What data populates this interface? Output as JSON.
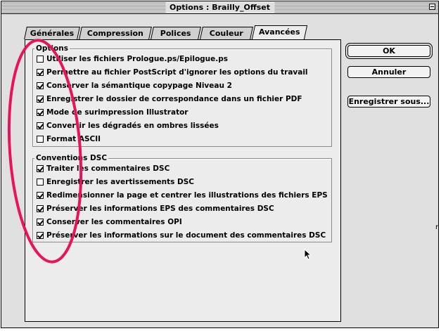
{
  "window": {
    "title": "Options : Brailly_Offset"
  },
  "tabs": [
    {
      "label": "Générales",
      "active": false
    },
    {
      "label": "Compression",
      "active": false
    },
    {
      "label": "Polices",
      "active": false
    },
    {
      "label": "Couleur",
      "active": false
    },
    {
      "label": "Avancées",
      "active": true
    }
  ],
  "options_group": {
    "title": "Options",
    "items": [
      {
        "label": "Utiliser les fichiers Prologue.ps/Epilogue.ps",
        "checked": false
      },
      {
        "label": "Permettre au fichier PostScript d'ignorer les options du travail",
        "checked": true
      },
      {
        "label": "Conserver la sémantique copypage Niveau 2",
        "checked": true
      },
      {
        "label": "Enregistrer le dossier de correspondance dans un fichier PDF",
        "checked": true
      },
      {
        "label": "Mode de surimpression Illustrator",
        "checked": true
      },
      {
        "label": "Convertir les dégradés en ombres lissées",
        "checked": true
      },
      {
        "label": "Format ASCII",
        "checked": false
      }
    ]
  },
  "dsc_group": {
    "title": "Conventions DSC",
    "items": [
      {
        "label": "Traiter les commentaires DSC",
        "checked": true
      },
      {
        "label": "Enregistrer les avertissements DSC",
        "checked": false
      },
      {
        "label": "Redimensionner la page et centrer les illustrations des fichiers EPS",
        "checked": true
      },
      {
        "label": "Préserver les informations EPS des commentaires DSC",
        "checked": true
      },
      {
        "label": "Conserver les commentaires OPI",
        "checked": true
      },
      {
        "label": "Préserver les informations sur le document des commentaires DSC",
        "checked": true
      }
    ]
  },
  "buttons": {
    "ok": "OK",
    "cancel": "Annuler",
    "save_as": "Enregistrer sous..."
  },
  "stray_text": "r",
  "annotation_color": "#e8145a"
}
